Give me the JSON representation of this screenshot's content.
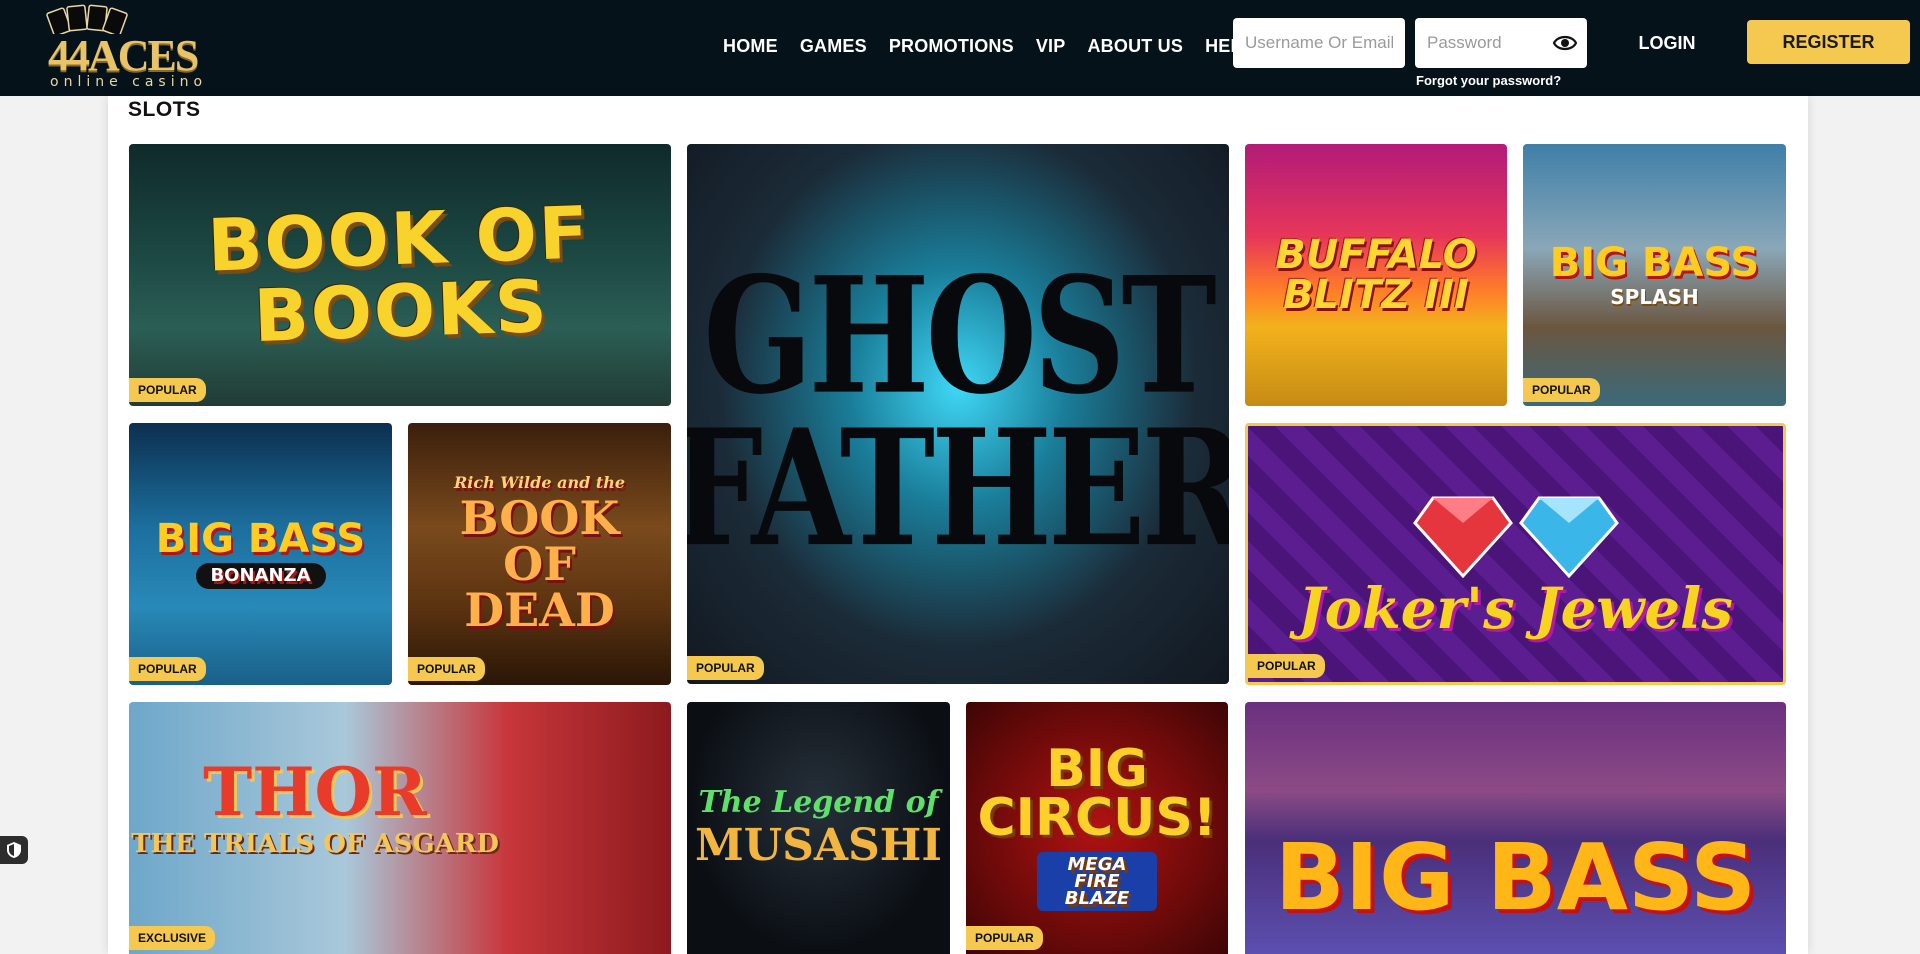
{
  "header": {
    "logo": {
      "brand": "44ACES",
      "tagline": "online casino"
    },
    "nav": [
      "HOME",
      "GAMES",
      "PROMOTIONS",
      "VIP",
      "ABOUT US",
      "HELP"
    ],
    "username_placeholder": "Username Or Email",
    "password_placeholder": "Password",
    "forgot_password": "Forgot your password?",
    "login_label": "LOGIN",
    "register_label": "REGISTER"
  },
  "section": {
    "title": "SLOTS"
  },
  "games": {
    "book_of_books": {
      "title": "BOOK OF BOOKS",
      "badge": "POPULAR"
    },
    "ghost_father": {
      "title_line1": "GHOST",
      "title_line2": "FATHER",
      "badge": "POPULAR"
    },
    "buffalo_blitz": {
      "title_line1": "BUFFALO",
      "title_line2": "BLITZ III"
    },
    "big_bass_splash": {
      "title": "BIG BASS",
      "subtitle": "SPLASH",
      "badge": "POPULAR"
    },
    "big_bass_bonanza": {
      "title": "BIG BASS",
      "subtitle": "BONANZA",
      "badge": "POPULAR"
    },
    "book_of_dead": {
      "pretitle": "Rich Wilde and the",
      "title_line1": "BOOK",
      "title_line2": "OF",
      "title_line3": "DEAD",
      "badge": "POPULAR"
    },
    "jokers_jewels": {
      "title": "Joker's Jewels",
      "badge": "POPULAR"
    },
    "thor": {
      "title": "THOR",
      "subtitle": "THE TRIALS OF ASGARD",
      "badge": "EXCLUSIVE"
    },
    "musashi": {
      "title": "The Legend of",
      "subtitle": "MUSASHI"
    },
    "big_circus": {
      "title_line1": "BIG",
      "title_line2": "CIRCUS!",
      "subtitle": "MEGA FIRE BLAZE",
      "badge": "POPULAR"
    },
    "big_bass_vegas": {
      "title": "BIG BASS"
    }
  },
  "colors": {
    "header_bg": "#06121a",
    "accent": "#f5c94f"
  }
}
